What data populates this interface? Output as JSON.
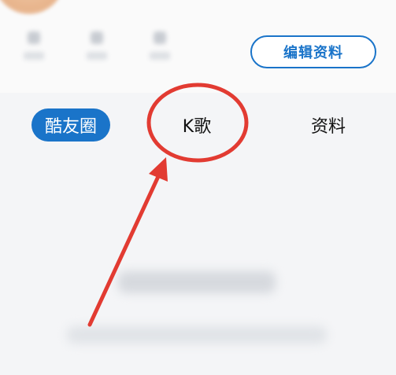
{
  "profile": {
    "edit_button_label": "编辑资料"
  },
  "tabs": [
    {
      "label": "酷友圈",
      "active": true
    },
    {
      "label": "K歌",
      "active": false
    },
    {
      "label": "资料",
      "active": false
    }
  ],
  "annotation": {
    "color": "#e23b32",
    "highlighted_tab": "K歌"
  },
  "colors": {
    "accent": "#1a74c9",
    "background": "#f4f5f7"
  }
}
